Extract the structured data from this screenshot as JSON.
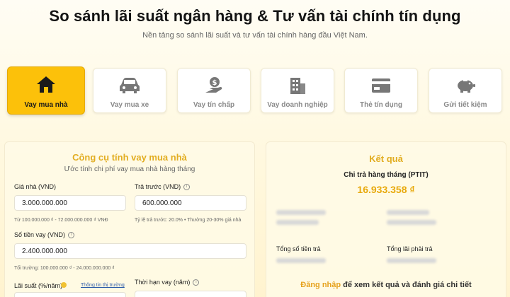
{
  "header": {
    "title": "So sánh lãi suất ngân hàng & Tư vấn tài chính tín dụng",
    "subtitle": "Nền tảng so sánh lãi suất và tư vấn tài chính hàng đầu Việt Nam."
  },
  "tabs": [
    {
      "label": "Vay mua nhà",
      "icon": "house-icon",
      "active": true
    },
    {
      "label": "Vay mua xe",
      "icon": "car-icon",
      "active": false
    },
    {
      "label": "Vay tín chấp",
      "icon": "hand-money-icon",
      "active": false
    },
    {
      "label": "Vay doanh nghiệp",
      "icon": "building-icon",
      "active": false
    },
    {
      "label": "Thẻ tín dụng",
      "icon": "credit-card-icon",
      "active": false
    },
    {
      "label": "Gửi tiết kiệm",
      "icon": "piggy-bank-icon",
      "active": false
    }
  ],
  "calculator": {
    "title": "Công cụ tính vay mua nhà",
    "subtitle": "Ước tính chi phí vay mua nhà hàng tháng",
    "house_price": {
      "label": "Giá nhà (VND)",
      "value": "3.000.000.000",
      "hint": "Từ 100.000.000 ₫ - 72.000.000.000 ₫ VNĐ"
    },
    "down_payment": {
      "label": "Trả trước (VND)",
      "value": "600.000.000",
      "hint": "Tỷ lệ trả trước: 20.0% • Thường 20-30% giá nhà"
    },
    "loan_amount": {
      "label": "Số tiền vay (VND)",
      "value": "2.400.000.000",
      "hint": "Tối trường: 100.000.000 ₫ - 24.000.000.000 ₫"
    },
    "interest_rate": {
      "label": "Lãi suất (%/năm)",
      "link": "Thông tin thị trường"
    },
    "term": {
      "label": "Thời hạn vay (năm)"
    }
  },
  "result": {
    "title": "Kết quả",
    "monthly_label": "Chi trả hàng tháng (PTIT)",
    "monthly_value": "16.933.358 ₫",
    "total_paid_label": "Tổng số tiền trả",
    "total_interest_label": "Tổng lãi phải trả",
    "login_link": "Đăng nhập",
    "login_text": " để xem kết quả và đánh giá chi tiết"
  },
  "colors": {
    "accent": "#fcc10a",
    "accent_text": "#e2ad21",
    "link": "#2b5aa8"
  }
}
